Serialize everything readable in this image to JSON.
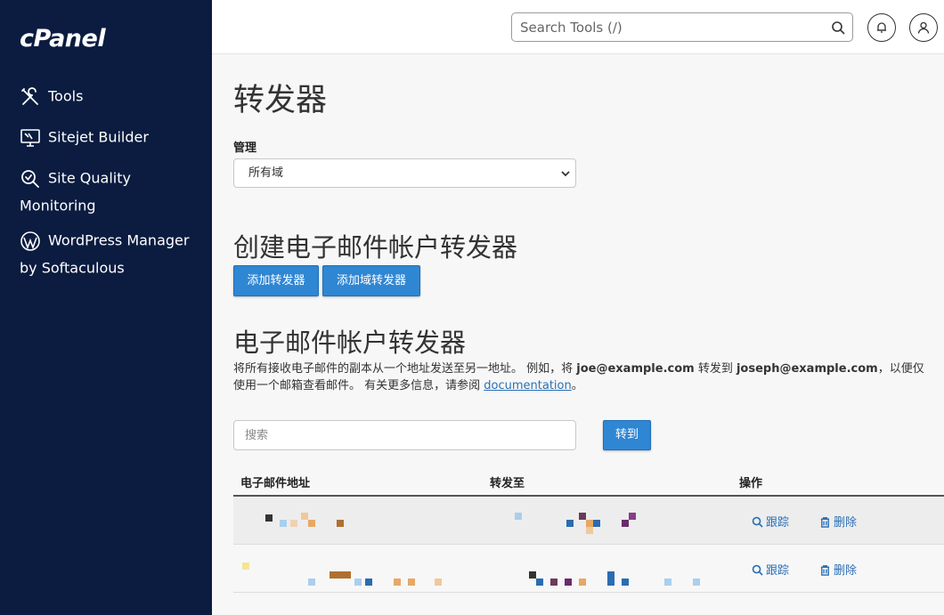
{
  "sidebar": {
    "logo": "cPanel",
    "items": [
      {
        "label": "Tools",
        "icon": "tools-icon"
      },
      {
        "label": "Sitejet Builder",
        "icon": "monitor-icon"
      },
      {
        "label": "Site Quality Monitoring",
        "icon": "magnifier-check-icon"
      },
      {
        "label": "WordPress Manager by Softaculous",
        "icon": "wordpress-icon"
      }
    ]
  },
  "topbar": {
    "search_placeholder": "Search Tools (/)"
  },
  "main": {
    "title": "转发器",
    "manage_label": "管理",
    "domain_select_value": "所有域",
    "create_heading": "创建电子邮件帐户转发器",
    "add_forwarder": "添加转发器",
    "add_domain_forwarder": "添加域转发器",
    "list_heading": "电子邮件帐户转发器",
    "desc": {
      "p1": "将所有接收电子邮件的副本从一个地址发送至另一地址。 例如，将 ",
      "email1": "joe@example.com",
      "p2": " 转发到 ",
      "email2": "joseph@example.com",
      "p3": "，以便仅",
      "p4": "使用一个邮箱查看邮件。 有关更多信息，请参阅 ",
      "link": "documentation",
      "p5": "。"
    },
    "search_placeholder": "搜索",
    "go_button": "转到",
    "table": {
      "columns": [
        "电子邮件地址",
        "转发至",
        "操作"
      ],
      "rows": [
        {
          "track": "跟踪",
          "delete": "删除"
        },
        {
          "track": "跟踪",
          "delete": "删除"
        }
      ]
    }
  },
  "colors": {
    "sidebar_bg": "#0b1c40",
    "button_blue": "#2f86d3",
    "link": "#2a6fb5"
  }
}
